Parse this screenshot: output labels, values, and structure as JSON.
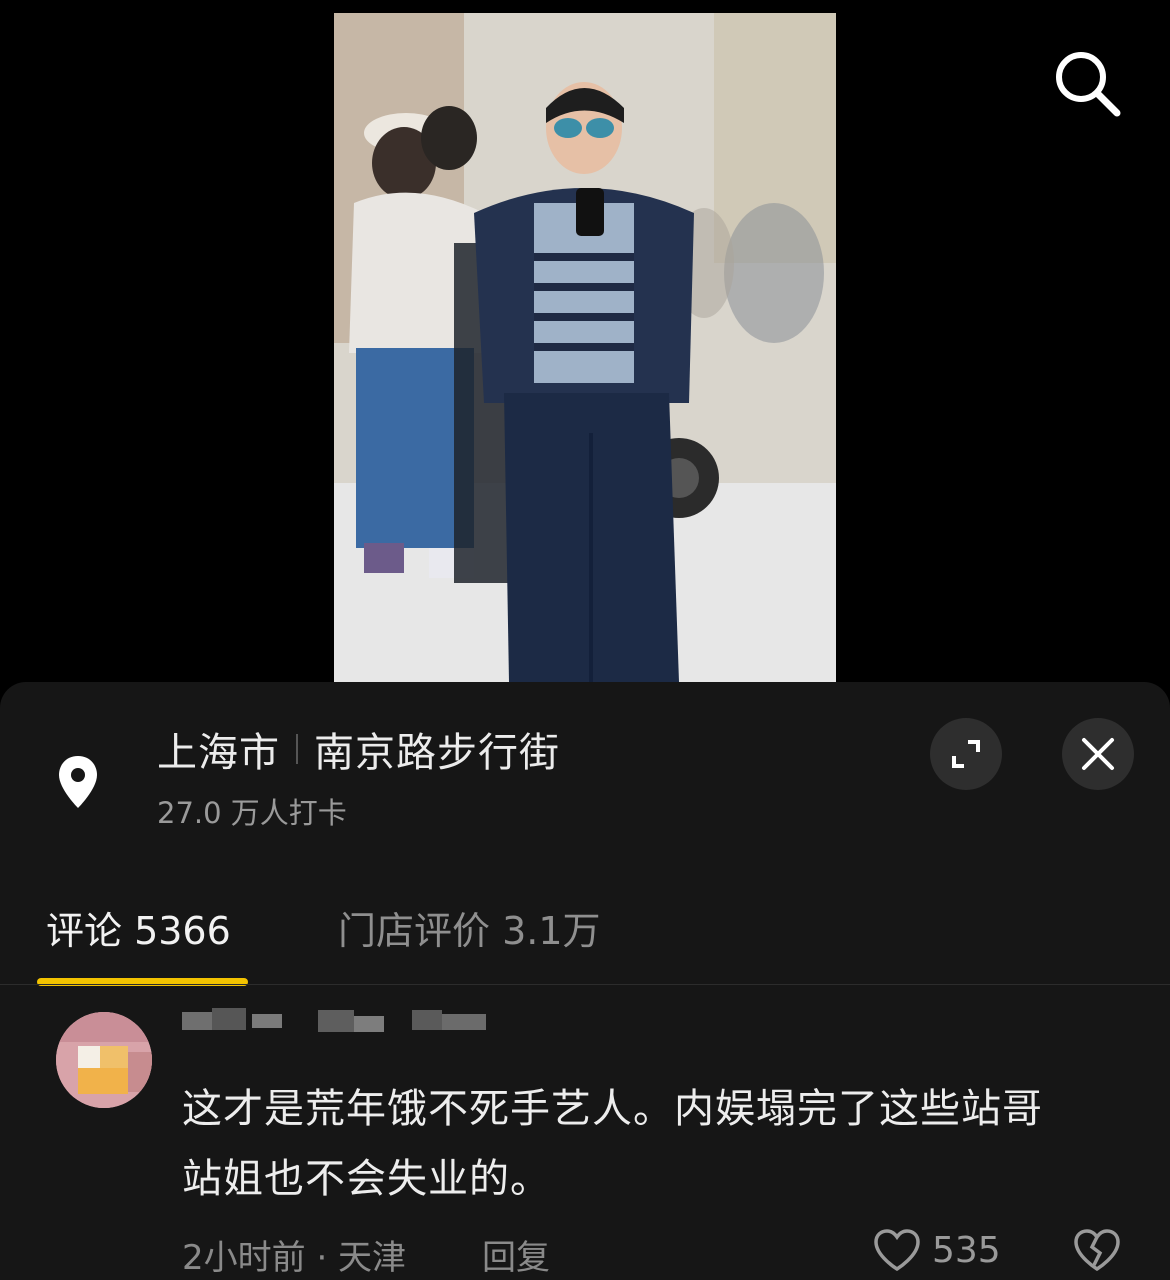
{
  "location": {
    "city": "上海市",
    "place": "南京路步行街",
    "checkins": "27.0 万人打卡"
  },
  "tabs": {
    "comments_label": "评论 5366",
    "reviews_label": "门店评价 3.1万"
  },
  "comment": {
    "text_line1": "这才是荒年饿不死手艺人。内娱塌完了这些站哥",
    "text_line2": "站姐也不会失业的。",
    "meta": "2小时前 · 天津",
    "reply_label": "回复",
    "likes": "535"
  },
  "colors": {
    "accent_underline": "#f3c300",
    "sheet_background": "#161616",
    "page_background": "#000000"
  },
  "icons": [
    "search-icon",
    "location-pin-icon",
    "expand-icon",
    "close-icon",
    "heart-icon",
    "broken-heart-icon"
  ]
}
